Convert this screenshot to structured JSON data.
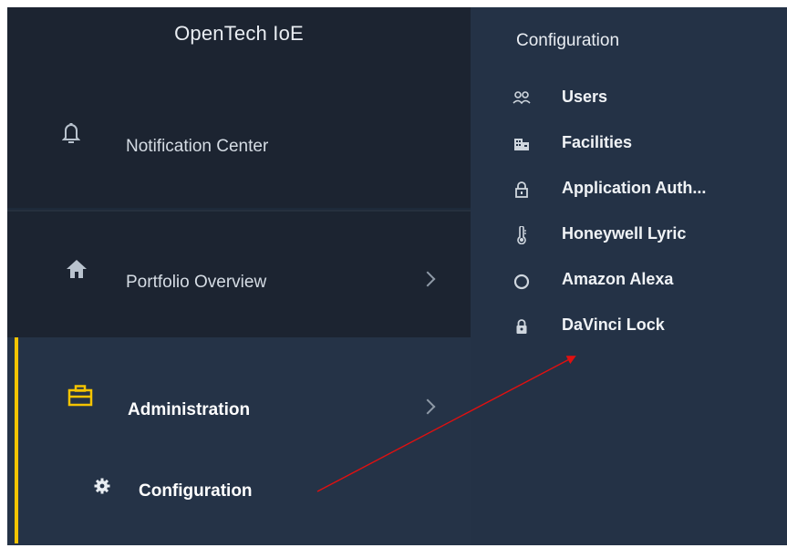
{
  "brand": {
    "title": "OpenTech IoE"
  },
  "sidebar": {
    "items": [
      {
        "label": "Notification Center",
        "icon": "bell-icon"
      },
      {
        "label": "Portfolio Overview",
        "icon": "home-icon"
      },
      {
        "label": "Administration",
        "icon": "briefcase-icon",
        "active": true
      },
      {
        "label": "Configuration",
        "icon": "gear-icon"
      }
    ]
  },
  "submenu": {
    "title": "Configuration",
    "items": [
      {
        "label": "Users",
        "icon": "users-icon"
      },
      {
        "label": "Facilities",
        "icon": "building-icon"
      },
      {
        "label": "Application Auth...",
        "icon": "lock-icon"
      },
      {
        "label": "Honeywell Lyric",
        "icon": "thermometer-icon"
      },
      {
        "label": "Amazon Alexa",
        "icon": "circle-icon"
      },
      {
        "label": "DaVinci Lock",
        "icon": "padlock-icon"
      }
    ]
  },
  "colors": {
    "accent": "#f5c400",
    "sidebar_bg": "#1c2431",
    "active_bg": "#253347",
    "submenu_bg": "#243246",
    "annotation_arrow": "#e01010"
  }
}
